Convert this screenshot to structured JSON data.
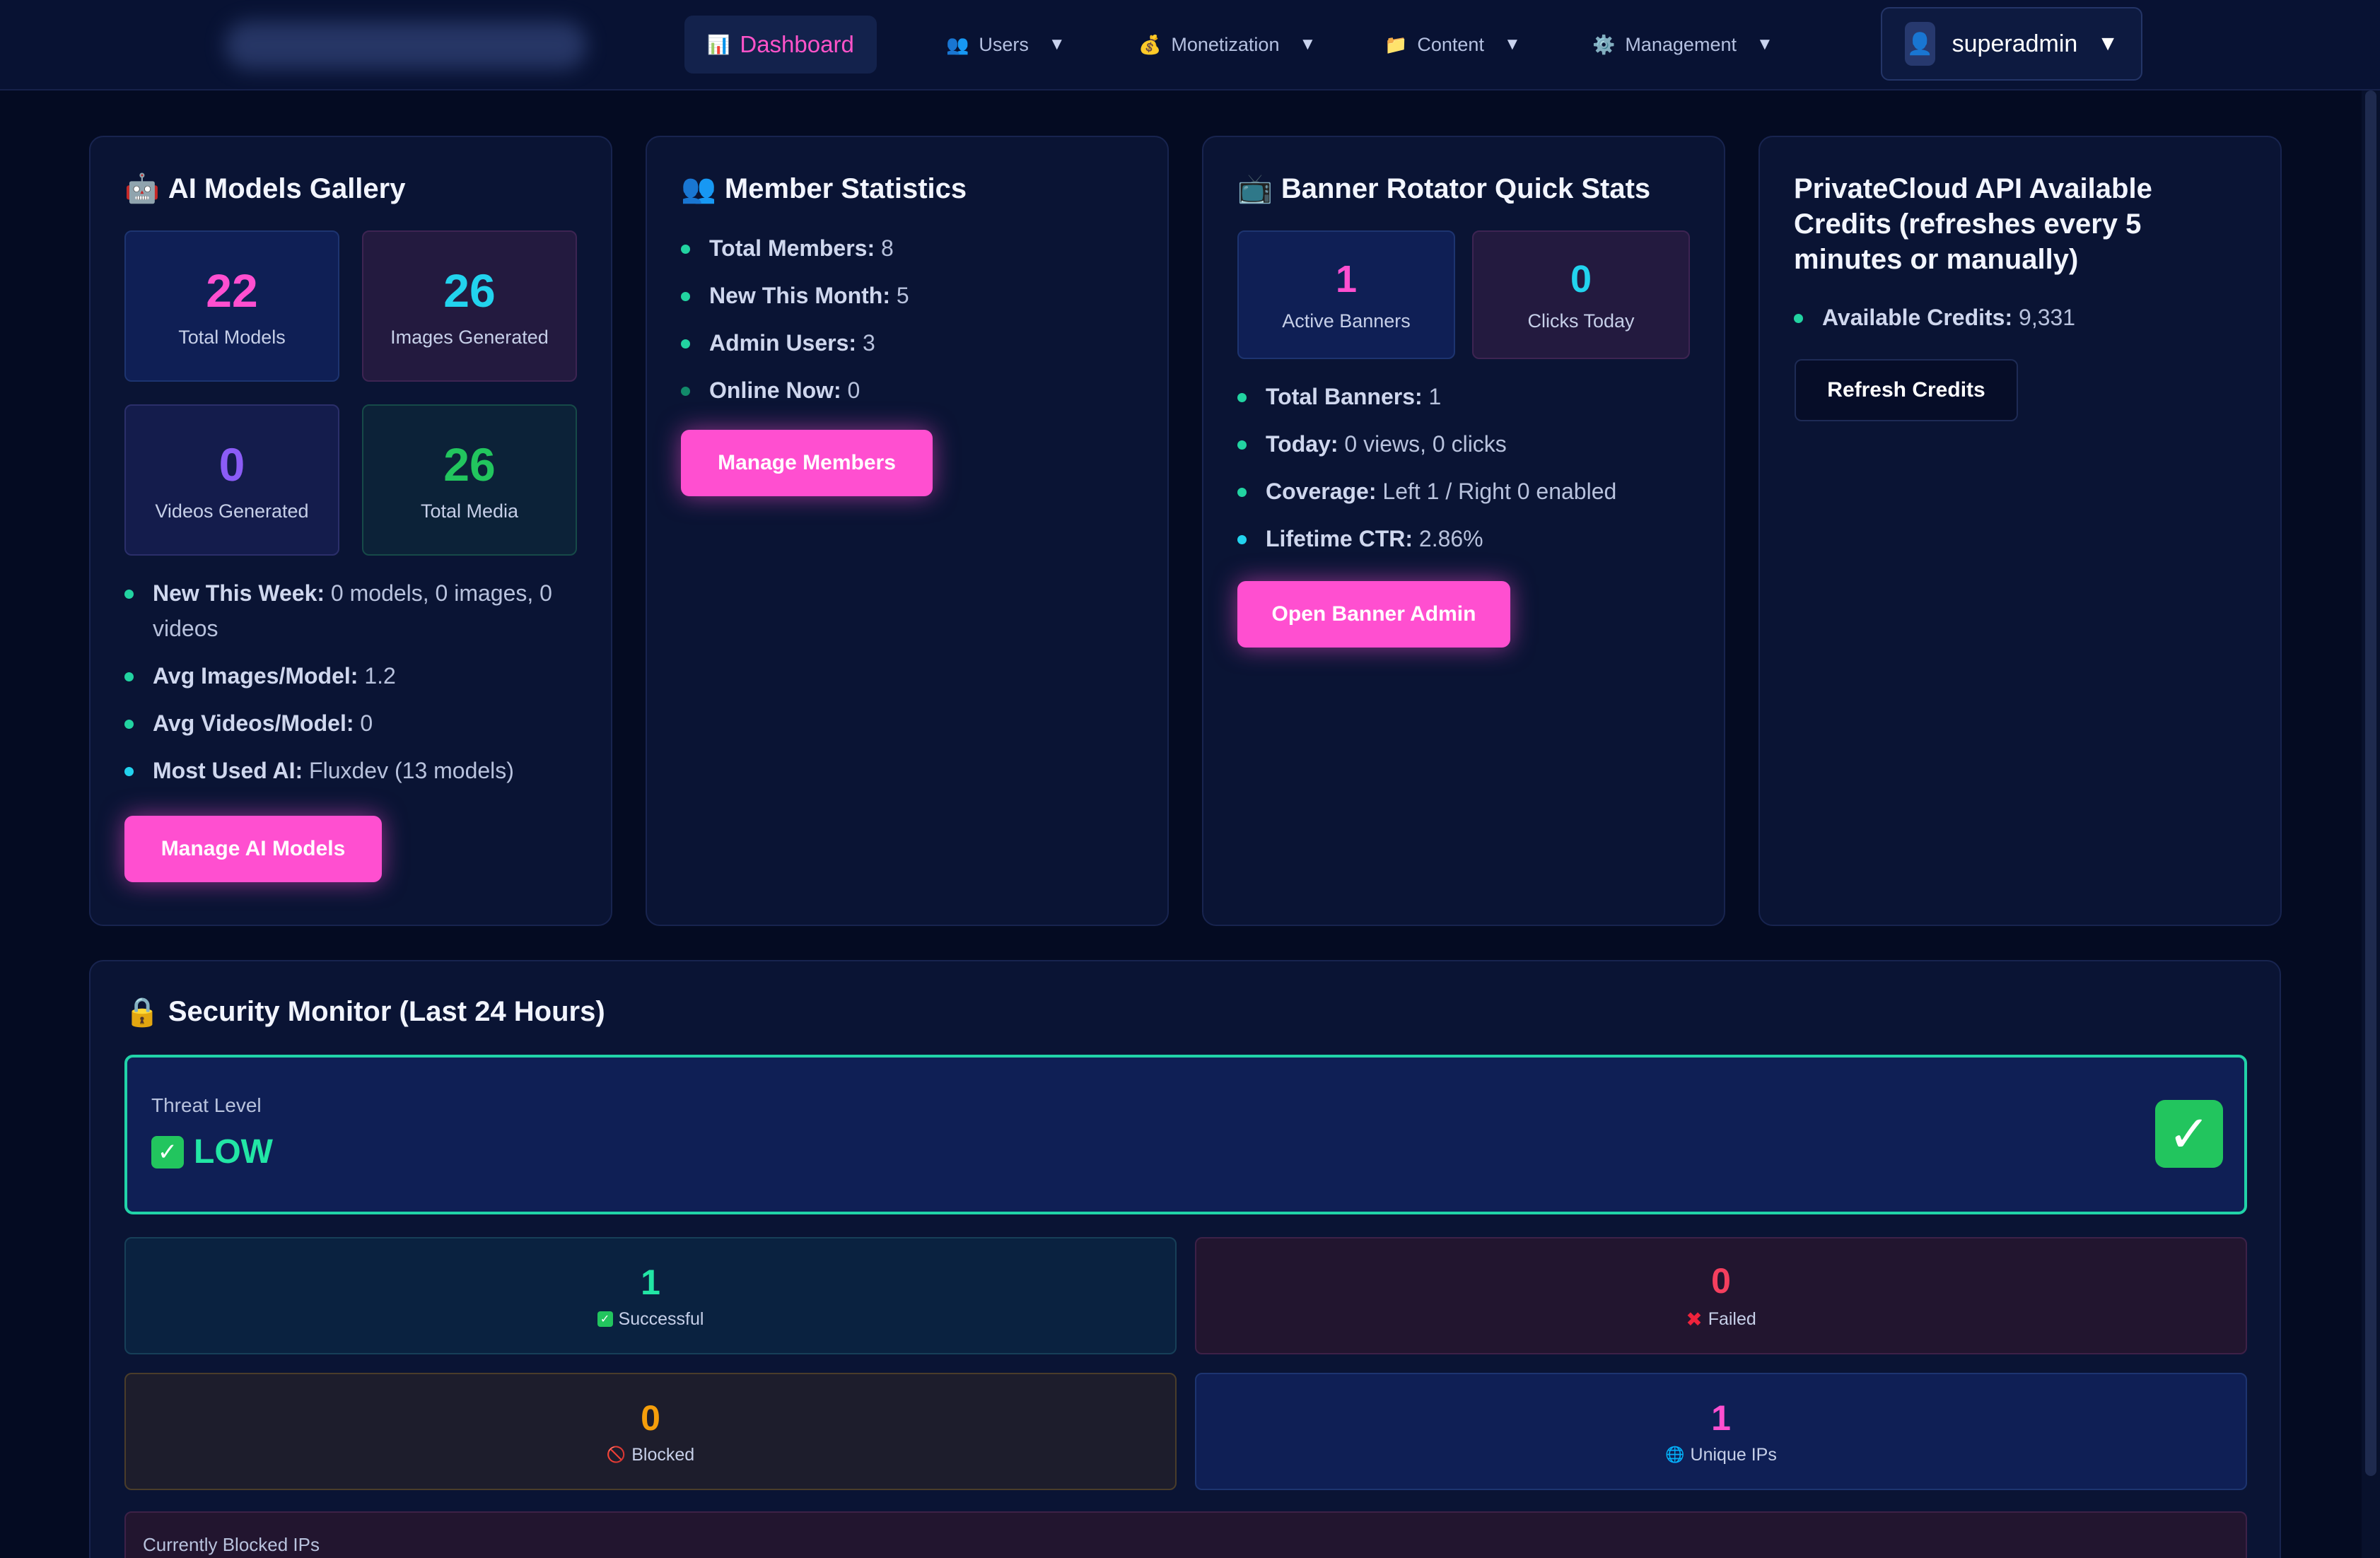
{
  "nav": {
    "dashboard": {
      "icon": "📊",
      "label": "Dashboard"
    },
    "users": {
      "icon": "👥",
      "label": "Users"
    },
    "monetization": {
      "icon": "💰",
      "label": "Monetization"
    },
    "content": {
      "icon": "📁",
      "label": "Content"
    },
    "management": {
      "icon": "⚙️",
      "label": "Management"
    },
    "caret": "▼",
    "user": {
      "icon": "👤",
      "name": "superadmin"
    }
  },
  "ai_models": {
    "icon": "🤖",
    "title": "AI Models Gallery",
    "tiles": [
      {
        "value": "22",
        "label": "Total Models"
      },
      {
        "value": "26",
        "label": "Images Generated"
      },
      {
        "value": "0",
        "label": "Videos Generated"
      },
      {
        "value": "26",
        "label": "Total Media"
      }
    ],
    "stats": [
      {
        "key": "New This Week:",
        "value": "0 models, 0 images, 0 videos"
      },
      {
        "key": "Avg Images/Model:",
        "value": "1.2"
      },
      {
        "key": "Avg Videos/Model:",
        "value": "0"
      },
      {
        "key": "Most Used AI:",
        "value": "Fluxdev (13 models)"
      }
    ],
    "button": "Manage AI Models"
  },
  "members": {
    "icon": "👥",
    "title": "Member Statistics",
    "stats": [
      {
        "key": "Total Members:",
        "value": "8"
      },
      {
        "key": "New This Month:",
        "value": "5"
      },
      {
        "key": "Admin Users:",
        "value": "3"
      },
      {
        "key": "Online Now:",
        "value": "0"
      }
    ],
    "button": "Manage Members"
  },
  "banners": {
    "icon": "📺",
    "title": "Banner Rotator Quick Stats",
    "tiles": [
      {
        "value": "1",
        "label": "Active Banners"
      },
      {
        "value": "0",
        "label": "Clicks Today"
      }
    ],
    "stats": [
      {
        "key": "Total Banners:",
        "value": "1"
      },
      {
        "key": "Today:",
        "value": "0 views, 0 clicks"
      },
      {
        "key": "Coverage:",
        "value": "Left 1 / Right 0 enabled"
      },
      {
        "key": "Lifetime CTR:",
        "value": "2.86%"
      }
    ],
    "button": "Open Banner Admin"
  },
  "credits": {
    "title": "PrivateCloud API Available Credits (refreshes every 5 minutes or manually)",
    "stats": [
      {
        "key": "Available Credits:",
        "value": "9,331"
      }
    ],
    "button": "Refresh Credits"
  },
  "security": {
    "icon": "🔒",
    "title": "Security Monitor (Last 24 Hours)",
    "threat_label": "Threat Level",
    "threat_value": "LOW",
    "check": "✓",
    "stats": [
      {
        "value": "1",
        "icon": "✓",
        "label": "Successful"
      },
      {
        "value": "0",
        "icon": "✖",
        "label": "Failed"
      },
      {
        "value": "0",
        "icon": "🚫",
        "label": "Blocked"
      },
      {
        "value": "1",
        "icon": "🌐",
        "label": "Unique IPs"
      }
    ],
    "blocked_ips_label": "Currently Blocked IPs"
  },
  "colors": {
    "accent_pink": "#ff4fd0",
    "cyan": "#22d3ee",
    "green": "#22e6a5",
    "purple": "#8b5cf6",
    "red": "#f43f5e",
    "orange": "#f59e0b"
  }
}
